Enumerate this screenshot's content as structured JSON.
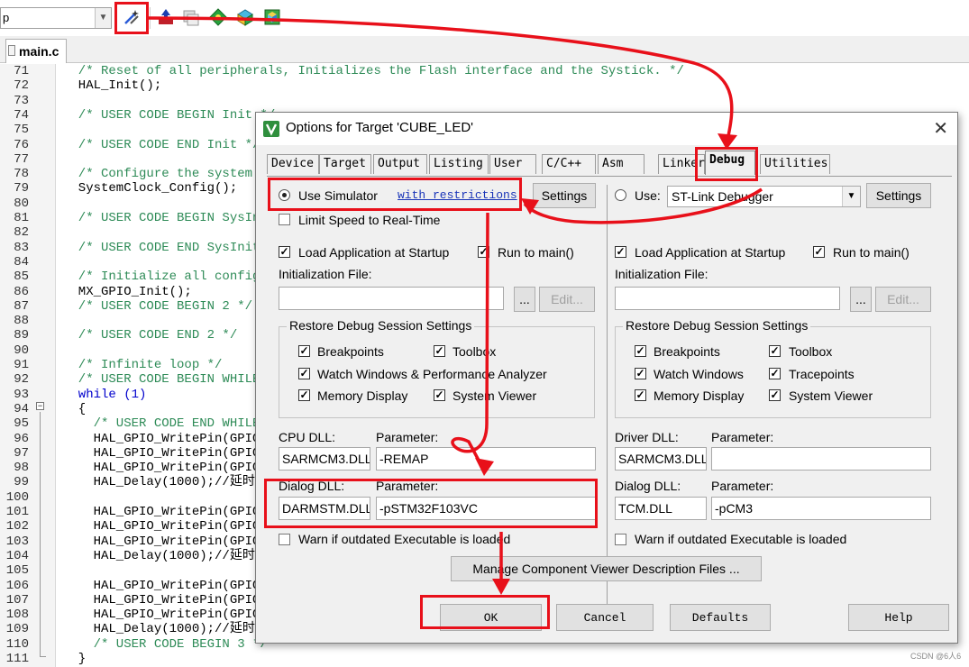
{
  "toolbar": {
    "target_combo_value": "p",
    "buttons": [
      {
        "name": "target-options-button",
        "icon": "wand-icon"
      },
      {
        "name": "load-button",
        "icon": "download-icon"
      },
      {
        "name": "copy-button",
        "icon": "pages-icon"
      },
      {
        "name": "manage-components-button",
        "icon": "green-diamond-icon"
      },
      {
        "name": "select-pack-button",
        "icon": "pack-icon"
      },
      {
        "name": "pack-installer-button",
        "icon": "installer-icon"
      }
    ]
  },
  "editor": {
    "tab_label": "main.c",
    "lines": [
      {
        "n": "71",
        "t": "  /* Reset of all peripherals, Initializes the Flash interface and the Systick. */",
        "k": "comment"
      },
      {
        "n": "72",
        "t": "  HAL_Init();",
        "k": "plain"
      },
      {
        "n": "73",
        "t": "",
        "k": "plain"
      },
      {
        "n": "74",
        "t": "  /* USER CODE BEGIN Init */",
        "k": "comment"
      },
      {
        "n": "75",
        "t": "",
        "k": "plain"
      },
      {
        "n": "76",
        "t": "  /* USER CODE END Init */",
        "k": "comment"
      },
      {
        "n": "77",
        "t": "",
        "k": "plain"
      },
      {
        "n": "78",
        "t": "  /* Configure the system",
        "k": "comment"
      },
      {
        "n": "79",
        "t": "  SystemClock_Config();",
        "k": "plain"
      },
      {
        "n": "80",
        "t": "",
        "k": "plain"
      },
      {
        "n": "81",
        "t": "  /* USER CODE BEGIN SysIn",
        "k": "comment"
      },
      {
        "n": "82",
        "t": "",
        "k": "plain"
      },
      {
        "n": "83",
        "t": "  /* USER CODE END SysInit",
        "k": "comment"
      },
      {
        "n": "84",
        "t": "",
        "k": "plain"
      },
      {
        "n": "85",
        "t": "  /* Initialize all config",
        "k": "comment"
      },
      {
        "n": "86",
        "t": "  MX_GPIO_Init();",
        "k": "plain"
      },
      {
        "n": "87",
        "t": "  /* USER CODE BEGIN 2 */",
        "k": "comment"
      },
      {
        "n": "88",
        "t": "",
        "k": "plain"
      },
      {
        "n": "89",
        "t": "  /* USER CODE END 2 */",
        "k": "comment"
      },
      {
        "n": "90",
        "t": "",
        "k": "plain"
      },
      {
        "n": "91",
        "t": "  /* Infinite loop */",
        "k": "comment"
      },
      {
        "n": "92",
        "t": "  /* USER CODE BEGIN WHILE",
        "k": "comment"
      },
      {
        "n": "93",
        "t": "  while (1)",
        "k": "keyword"
      },
      {
        "n": "94",
        "t": "  {",
        "k": "plain"
      },
      {
        "n": "95",
        "t": "    /* USER CODE END WHILE",
        "k": "comment"
      },
      {
        "n": "96",
        "t": "    HAL_GPIO_WritePin(GPIO",
        "k": "plain"
      },
      {
        "n": "97",
        "t": "    HAL_GPIO_WritePin(GPIO",
        "k": "plain"
      },
      {
        "n": "98",
        "t": "    HAL_GPIO_WritePin(GPIO",
        "k": "plain"
      },
      {
        "n": "99",
        "t": "    HAL_Delay(1000);//延时",
        "k": "plain"
      },
      {
        "n": "100",
        "t": "",
        "k": "plain"
      },
      {
        "n": "101",
        "t": "    HAL_GPIO_WritePin(GPIO",
        "k": "plain"
      },
      {
        "n": "102",
        "t": "    HAL_GPIO_WritePin(GPIO",
        "k": "plain"
      },
      {
        "n": "103",
        "t": "    HAL_GPIO_WritePin(GPIO",
        "k": "plain"
      },
      {
        "n": "104",
        "t": "    HAL_Delay(1000);//延时",
        "k": "plain"
      },
      {
        "n": "105",
        "t": "",
        "k": "plain"
      },
      {
        "n": "106",
        "t": "    HAL_GPIO_WritePin(GPIO",
        "k": "plain"
      },
      {
        "n": "107",
        "t": "    HAL_GPIO_WritePin(GPIO",
        "k": "plain"
      },
      {
        "n": "108",
        "t": "    HAL_GPIO_WritePin(GPIO",
        "k": "plain"
      },
      {
        "n": "109",
        "t": "    HAL_Delay(1000);//延时",
        "k": "plain"
      },
      {
        "n": "110",
        "t": "    /* USER CODE BEGIN 3 */",
        "k": "comment"
      },
      {
        "n": "111",
        "t": "  }",
        "k": "plain"
      }
    ]
  },
  "dialog": {
    "title": "Options for Target 'CUBE_LED'",
    "close_label": "✕",
    "tabs": [
      "Device",
      "Target",
      "Output",
      "Listing",
      "User",
      "C/C++",
      "Asm",
      "Linker",
      "Debug",
      "Utilities"
    ],
    "active_tab": "Debug",
    "left": {
      "use_simulator_label": "Use Simulator",
      "restrictions_link": "with restrictions",
      "settings_label": "Settings",
      "limit_speed_label": "Limit Speed to Real-Time",
      "load_app_label": "Load Application at Startup",
      "run_to_main_label": "Run to main()",
      "init_file_label": "Initialization File:",
      "browse_label": "...",
      "edit_label": "Edit...",
      "restore_group_title": "Restore Debug Session Settings",
      "breakpoints_label": "Breakpoints",
      "toolbox_label": "Toolbox",
      "watch_label": "Watch Windows & Performance Analyzer",
      "memory_label": "Memory Display",
      "sysviewer_label": "System Viewer",
      "cpu_dll_label": "CPU DLL:",
      "cpu_param_label": "Parameter:",
      "cpu_dll_value": "SARMCM3.DLL",
      "cpu_param_value": "-REMAP",
      "dialog_dll_label": "Dialog DLL:",
      "dialog_param_label": "Parameter:",
      "dialog_dll_value": "DARMSTM.DLL",
      "dialog_param_value": "-pSTM32F103VC",
      "warn_label": "Warn if outdated Executable is loaded"
    },
    "right": {
      "use_label": "Use:",
      "debugger_value": "ST-Link Debugger",
      "settings_label": "Settings",
      "load_app_label": "Load Application at Startup",
      "run_to_main_label": "Run to main()",
      "init_file_label": "Initialization File:",
      "browse_label": "...",
      "edit_label": "Edit...",
      "restore_group_title": "Restore Debug Session Settings",
      "breakpoints_label": "Breakpoints",
      "toolbox_label": "Toolbox",
      "watch_label": "Watch Windows",
      "tracepoints_label": "Tracepoints",
      "memory_label": "Memory Display",
      "sysviewer_label": "System Viewer",
      "driver_dll_label": "Driver DLL:",
      "driver_param_label": "Parameter:",
      "driver_dll_value": "SARMCM3.DLL",
      "driver_param_value": "",
      "dialog_dll_label": "Dialog DLL:",
      "dialog_param_label": "Parameter:",
      "dialog_dll_value": "TCM.DLL",
      "dialog_param_value": "-pCM3",
      "warn_label": "Warn if outdated Executable is loaded"
    },
    "manage_label": "Manage Component Viewer Description Files ...",
    "ok_label": "OK",
    "cancel_label": "Cancel",
    "defaults_label": "Defaults",
    "help_label": "Help"
  },
  "watermark": "CSDN @6人6",
  "colors": {
    "annotation": "#e8101a",
    "comment": "#2e8b57",
    "keyword": "#0000cc",
    "link": "#1a35b8"
  }
}
